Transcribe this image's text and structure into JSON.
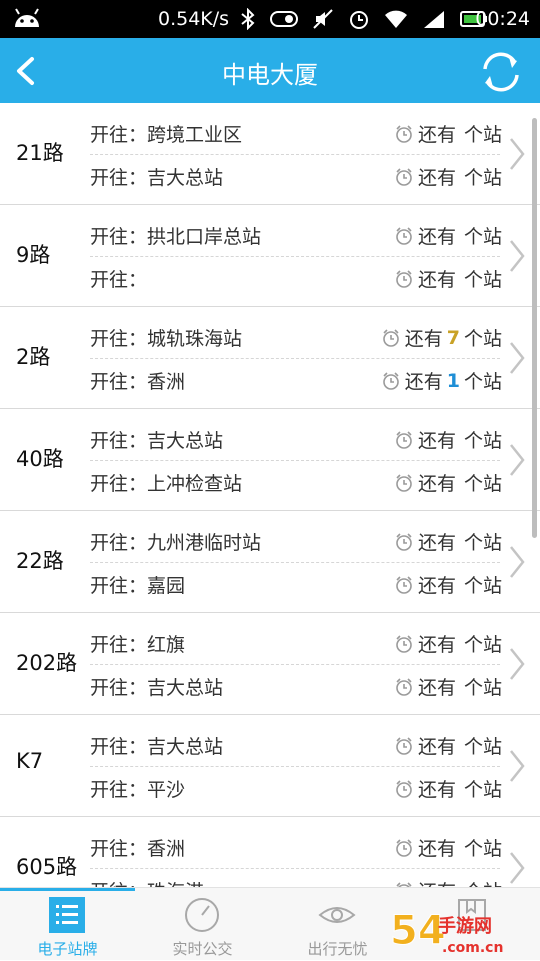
{
  "status_bar": {
    "net_speed": "0.54K/s",
    "time": "00:24"
  },
  "header": {
    "title": "中电大厦"
  },
  "routes": [
    {
      "name": "21路",
      "d1": {
        "prefix": "开往：",
        "dest": "跨境工业区",
        "pre": "还有",
        "num": "",
        "post": "个站"
      },
      "d2": {
        "prefix": "开往：",
        "dest": "吉大总站",
        "pre": "还有",
        "num": "",
        "post": "个站"
      }
    },
    {
      "name": "9路",
      "d1": {
        "prefix": "开往：",
        "dest": "拱北口岸总站",
        "pre": "还有",
        "num": "",
        "post": "个站"
      },
      "d2": {
        "prefix": "开往：",
        "dest": "",
        "pre": "还有",
        "num": "",
        "post": "个站"
      }
    },
    {
      "name": "2路",
      "d1": {
        "prefix": "开往：",
        "dest": "城轨珠海站",
        "pre": "还有",
        "num": "7",
        "post": "个站"
      },
      "d2": {
        "prefix": "开往：",
        "dest": "香洲",
        "pre": "还有",
        "num": "1",
        "post": "个站"
      }
    },
    {
      "name": "40路",
      "d1": {
        "prefix": "开往：",
        "dest": "吉大总站",
        "pre": "还有",
        "num": "",
        "post": "个站"
      },
      "d2": {
        "prefix": "开往：",
        "dest": "上冲检查站",
        "pre": "还有",
        "num": "",
        "post": "个站"
      }
    },
    {
      "name": "22路",
      "d1": {
        "prefix": "开往：",
        "dest": "九州港临时站",
        "pre": "还有",
        "num": "",
        "post": "个站"
      },
      "d2": {
        "prefix": "开往：",
        "dest": "嘉园",
        "pre": "还有",
        "num": "",
        "post": "个站"
      }
    },
    {
      "name": "202路",
      "d1": {
        "prefix": "开往：",
        "dest": "红旗",
        "pre": "还有",
        "num": "",
        "post": "个站"
      },
      "d2": {
        "prefix": "开往：",
        "dest": "吉大总站",
        "pre": "还有",
        "num": "",
        "post": "个站"
      }
    },
    {
      "name": "K7",
      "d1": {
        "prefix": "开往：",
        "dest": "吉大总站",
        "pre": "还有",
        "num": "",
        "post": "个站"
      },
      "d2": {
        "prefix": "开往：",
        "dest": "平沙",
        "pre": "还有",
        "num": "",
        "post": "个站"
      }
    },
    {
      "name": "605路",
      "d1": {
        "prefix": "开往：",
        "dest": "香洲",
        "pre": "还有",
        "num": "",
        "post": "个站"
      },
      "d2": {
        "prefix": "开往：",
        "dest": "珠海港",
        "pre": "还有",
        "num": "",
        "post": "个站"
      }
    }
  ],
  "colors": {
    "accent": "#29aee8",
    "num_far": "#c9a227",
    "num_near": "#1f8fd6"
  },
  "tabs": [
    {
      "label": "电子站牌",
      "icon": "list-icon",
      "active": true
    },
    {
      "label": "实时公交",
      "icon": "gauge-icon",
      "active": false
    },
    {
      "label": "出行无忧",
      "icon": "eye-icon",
      "active": false
    },
    {
      "label": "",
      "icon": "book-icon",
      "active": false
    }
  ],
  "watermark": {
    "text": "54手游网",
    "sub": ".com.cn"
  }
}
